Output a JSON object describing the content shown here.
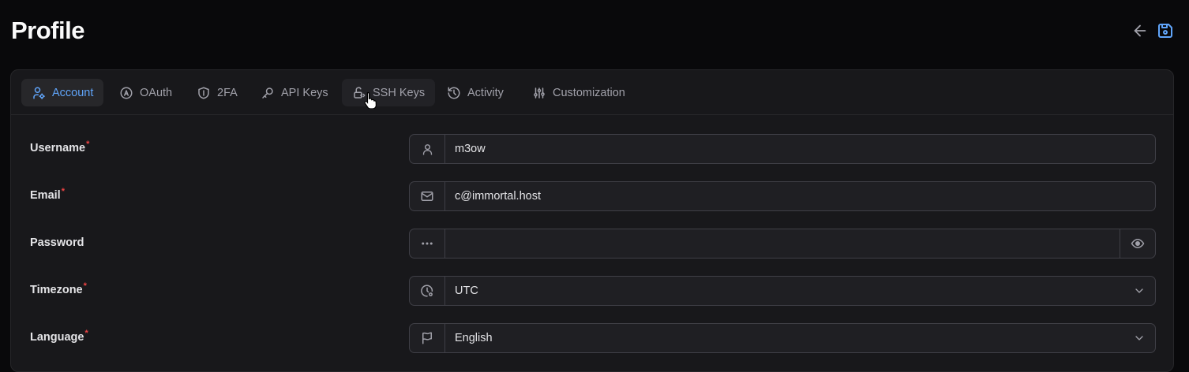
{
  "header": {
    "title": "Profile",
    "back_icon": "arrow-left-icon",
    "save_icon": "save-icon",
    "accent": "#60a5fa"
  },
  "tabs": [
    {
      "label": "Account",
      "icon": "user-cog-icon",
      "active": true
    },
    {
      "label": "OAuth",
      "icon": "oauth-icon",
      "active": false
    },
    {
      "label": "2FA",
      "icon": "shield-icon",
      "active": false
    },
    {
      "label": "API Keys",
      "icon": "key-icon",
      "active": false
    },
    {
      "label": "SSH Keys",
      "icon": "lock-code-icon",
      "active": false,
      "hovered": true
    },
    {
      "label": "Activity",
      "icon": "history-icon",
      "active": false
    },
    {
      "label": "Customization",
      "icon": "sliders-icon",
      "active": false
    }
  ],
  "form": {
    "username": {
      "label": "Username",
      "required_mark": "*",
      "value": "m3ow",
      "icon": "user-icon"
    },
    "email": {
      "label": "Email",
      "required_mark": "*",
      "value": "c@immortal.host",
      "icon": "mail-icon"
    },
    "password": {
      "label": "Password",
      "value": "",
      "icon": "dots-icon",
      "toggle_icon": "eye-icon"
    },
    "timezone": {
      "label": "Timezone",
      "required_mark": "*",
      "value": "UTC",
      "icon": "clock-cog-icon"
    },
    "language": {
      "label": "Language",
      "required_mark": "*",
      "value": "English",
      "icon": "flag-icon"
    }
  },
  "colors": {
    "background": "#09090b",
    "card": "#18181b",
    "border": "#3f3f46",
    "required": "#ef4444",
    "muted": "#a1a1aa"
  }
}
